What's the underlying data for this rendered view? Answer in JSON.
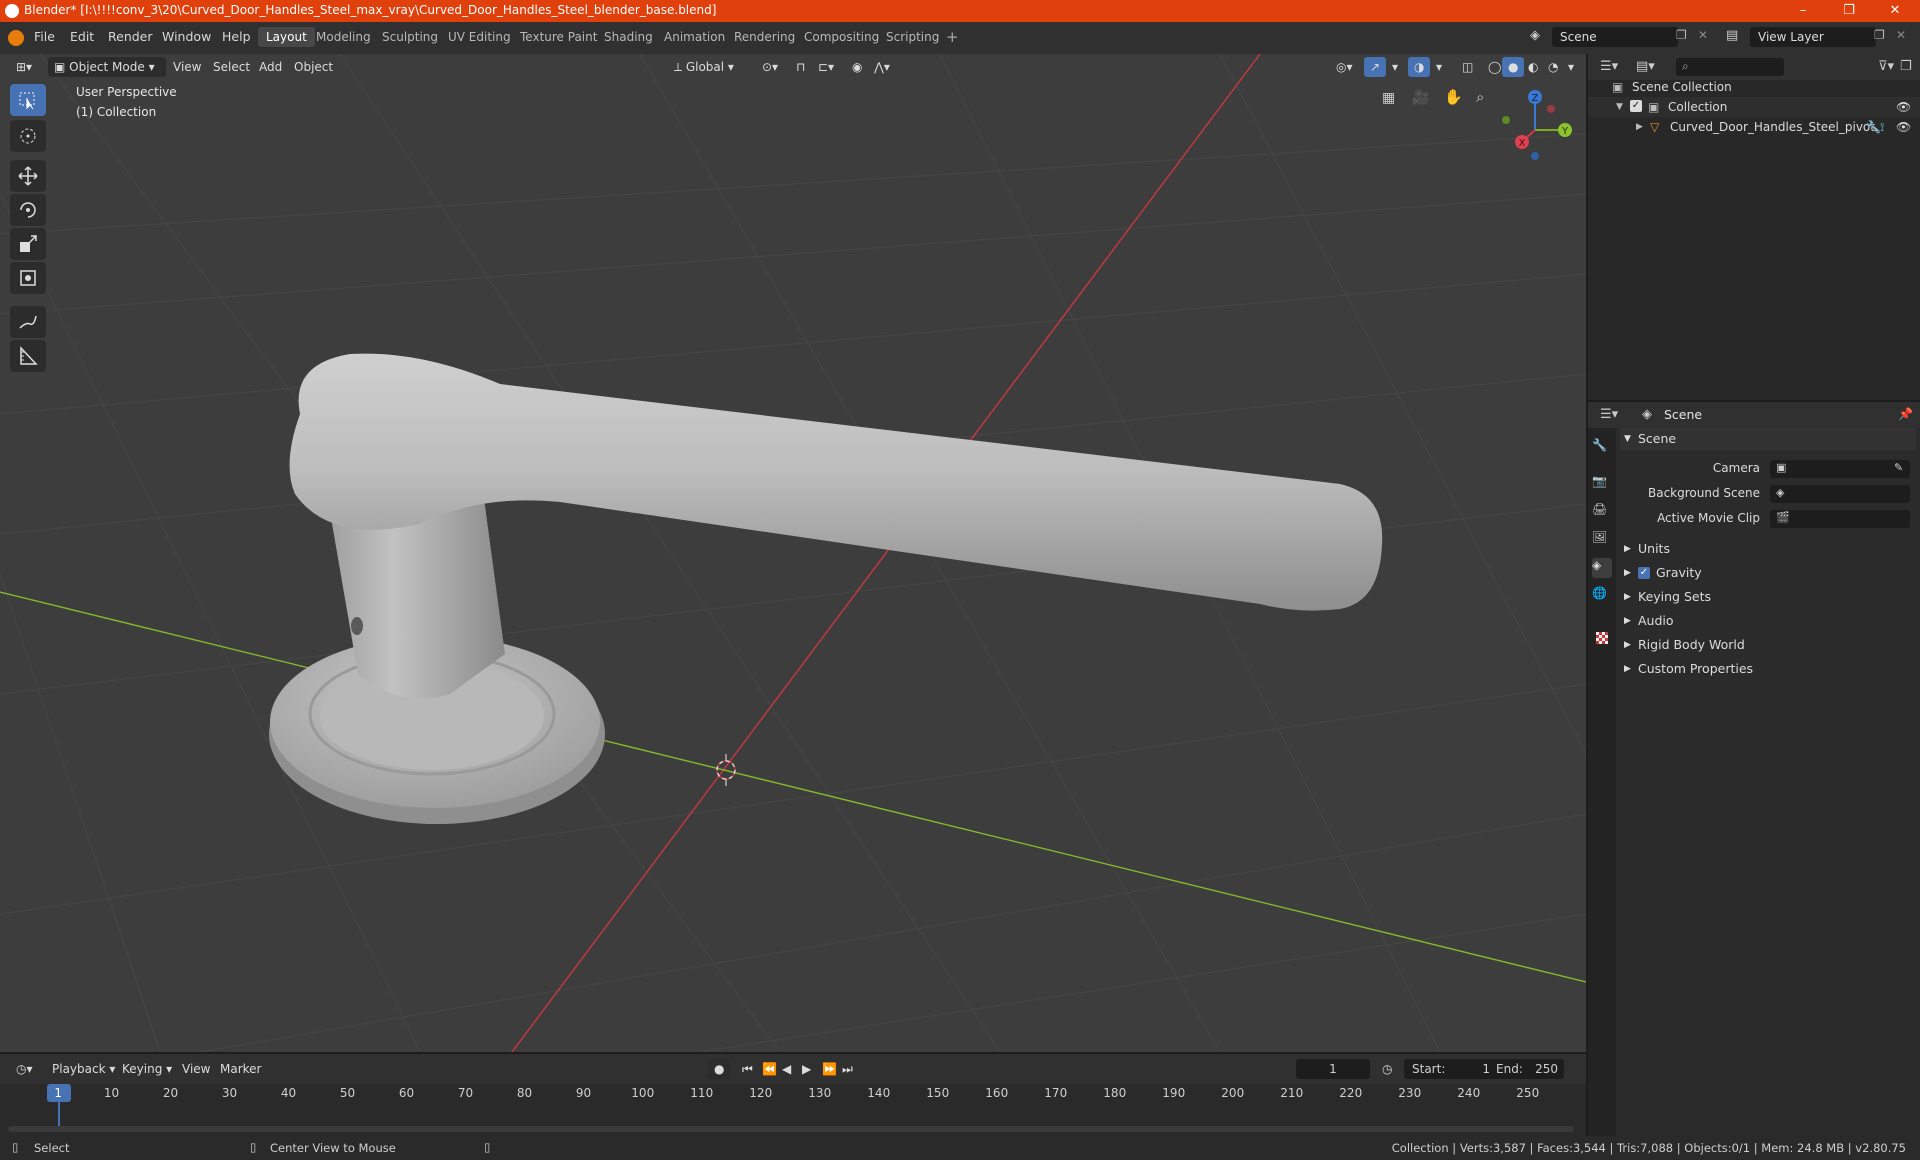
{
  "window": {
    "title": "Blender* [I:\\!!!!conv_3\\20\\Curved_Door_Handles_Steel_max_vray\\Curved_Door_Handles_Steel_blender_base.blend]",
    "controls": [
      "–",
      "❐",
      "✕"
    ]
  },
  "menus": [
    "File",
    "Edit",
    "Render",
    "Window",
    "Help"
  ],
  "workspaces": [
    "Layout",
    "Modeling",
    "Sculpting",
    "UV Editing",
    "Texture Paint",
    "Shading",
    "Animation",
    "Rendering",
    "Compositing",
    "Scripting"
  ],
  "active_workspace": "Layout",
  "scene_field": "Scene",
  "view_layer_field": "View Layer",
  "viewport": {
    "mode": "Object Mode",
    "header_menus": [
      "View",
      "Select",
      "Add",
      "Object"
    ],
    "transform_orientation": "Global",
    "overlay_line1": "User Perspective",
    "overlay_line2": "(1) Collection",
    "gizmo": {
      "x": "X",
      "y": "Y",
      "z": "Z"
    },
    "object_color": "#b9b9b9",
    "background_color": "#3d3d3d"
  },
  "outliner": {
    "root": "Scene Collection",
    "collection": "Collection",
    "object": "Curved_Door_Handles_Steel_pivot"
  },
  "properties": {
    "header": "Scene",
    "section": "Scene",
    "fields": [
      "Camera",
      "Background Scene",
      "Active Movie Clip"
    ],
    "subsections": [
      "Units",
      "Gravity",
      "Keying Sets",
      "Audio",
      "Rigid Body World",
      "Custom Properties"
    ],
    "gravity_checked": true
  },
  "timeline": {
    "menus": [
      "Playback",
      "Keying",
      "View",
      "Marker"
    ],
    "current_frame": "1",
    "start_label": "Start:",
    "start_value": "1",
    "end_label": "End:",
    "end_value": "250",
    "ticks": [
      "1",
      "10",
      "20",
      "30",
      "40",
      "50",
      "60",
      "70",
      "80",
      "90",
      "100",
      "110",
      "120",
      "130",
      "140",
      "150",
      "160",
      "170",
      "180",
      "190",
      "200",
      "210",
      "220",
      "230",
      "240",
      "250"
    ]
  },
  "statusbar": {
    "left": "Select",
    "middle": "Center View to Mouse",
    "right": "Collection | Verts:3,587 | Faces:3,544 | Tris:7,088 | Objects:0/1 | Mem: 24.8 MB | v2.80.75"
  },
  "colors": {
    "title_bar": "#e0400c",
    "accent_blue": "#4772b3",
    "x_axis": "#c8383f",
    "y_axis": "#84b82c"
  }
}
